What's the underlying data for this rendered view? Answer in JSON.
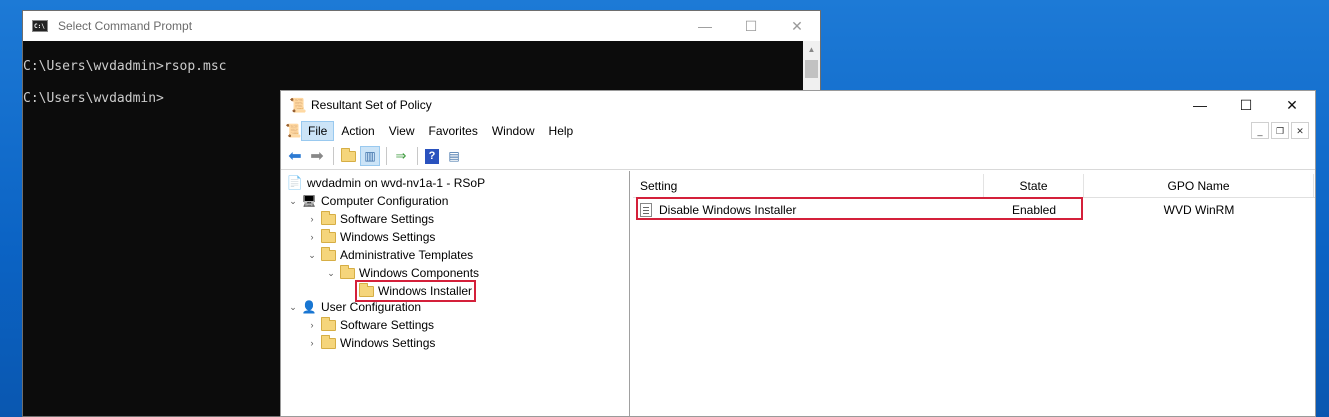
{
  "cmd": {
    "title": "Select Command Prompt",
    "icon_text": "C:\\",
    "controls": {
      "minimize": "—",
      "maximize": "☐",
      "close": "✕"
    },
    "lines": [
      "C:\\Users\\wvdadmin>rsop.msc",
      "C:\\Users\\wvdadmin>"
    ]
  },
  "mmc": {
    "title": "Resultant Set of Policy",
    "controls": {
      "minimize": "—",
      "maximize": "☐",
      "close": "✕"
    },
    "menu": [
      "File",
      "Action",
      "View",
      "Favorites",
      "Window",
      "Help"
    ],
    "active_menu": "File",
    "child_controls": {
      "minimize": "_",
      "restore": "❐",
      "close": "✕"
    },
    "toolbar_icons": [
      "back-arrow-icon",
      "forward-arrow-icon",
      "up-folder-icon",
      "show-hide-tree-icon",
      "export-list-icon",
      "help-icon",
      "properties-pane-icon"
    ],
    "tree": {
      "root": "wvdadmin on wvd-nv1a-1 - RSoP",
      "computer_config": "Computer Configuration",
      "cc_software": "Software Settings",
      "cc_windows": "Windows Settings",
      "cc_admin_templates": "Administrative Templates",
      "cc_windows_components": "Windows Components",
      "cc_windows_installer": "Windows Installer",
      "user_config": "User Configuration",
      "uc_software": "Software Settings",
      "uc_windows": "Windows Settings"
    },
    "list": {
      "headers": {
        "setting": "Setting",
        "state": "State",
        "gpo": "GPO Name"
      },
      "rows": [
        {
          "setting": "Disable Windows Installer",
          "state": "Enabled",
          "gpo": "WVD WinRM"
        }
      ]
    }
  },
  "colors": {
    "highlight_red": "#d4203a",
    "desktop_blue": "#0b63c4",
    "console_bg": "#0c0c0c"
  }
}
